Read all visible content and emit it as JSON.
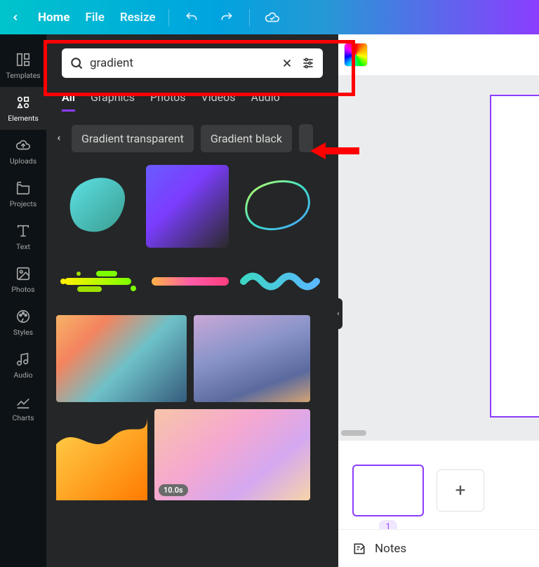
{
  "topbar": {
    "home": "Home",
    "file": "File",
    "resize": "Resize"
  },
  "rail": {
    "templates": "Templates",
    "elements": "Elements",
    "uploads": "Uploads",
    "projects": "Projects",
    "text": "Text",
    "photos": "Photos",
    "styles": "Styles",
    "audio": "Audio",
    "charts": "Charts"
  },
  "search": {
    "value": "gradient"
  },
  "tabs": {
    "all": "All",
    "graphics": "Graphics",
    "photos": "Photos",
    "videos": "Videos",
    "audio": "Audio"
  },
  "tags": {
    "transparent": "Gradient transparent",
    "black": "Gradient black"
  },
  "results": {
    "video_duration": "10.0s"
  },
  "pages": {
    "page1_label": "1",
    "add_symbol": "+"
  },
  "bottombar": {
    "notes": "Notes"
  }
}
